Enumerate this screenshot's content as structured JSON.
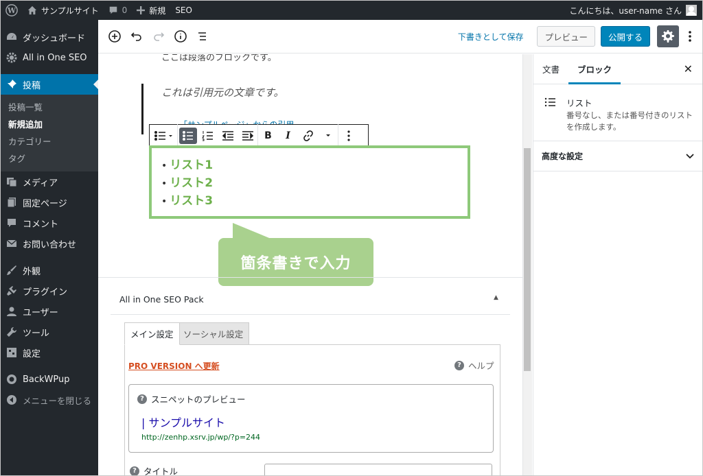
{
  "adminbar": {
    "site_name": "サンプルサイト",
    "comments_count": "0",
    "new_label": "新規",
    "seo_label": "SEO",
    "greeting": "こんにちは、user-name さん"
  },
  "sidebar": {
    "items": [
      {
        "label": "ダッシュボード",
        "icon": "dashboard-icon"
      },
      {
        "label": "All in One SEO",
        "icon": "gear-icon"
      },
      {
        "label": "投稿",
        "icon": "pin-icon"
      },
      {
        "label": "メディア",
        "icon": "media-icon"
      },
      {
        "label": "固定ページ",
        "icon": "page-icon"
      },
      {
        "label": "コメント",
        "icon": "comment-icon"
      },
      {
        "label": "お問い合わせ",
        "icon": "mail-icon"
      },
      {
        "label": "外観",
        "icon": "brush-icon"
      },
      {
        "label": "プラグイン",
        "icon": "plugin-icon"
      },
      {
        "label": "ユーザー",
        "icon": "user-icon"
      },
      {
        "label": "ツール",
        "icon": "wrench-icon"
      },
      {
        "label": "設定",
        "icon": "settings-icon"
      },
      {
        "label": "BackWPup",
        "icon": "backwpup-icon"
      },
      {
        "label": "メニューを閉じる",
        "icon": "collapse-icon"
      }
    ],
    "submenu": [
      "投稿一覧",
      "新規追加",
      "カテゴリー",
      "タグ"
    ]
  },
  "header": {
    "save_draft": "下書きとして保存",
    "preview": "プレビュー",
    "publish": "公開する"
  },
  "editor": {
    "paragraph_text": "ここは段落のブロックです。",
    "quote_text": "これは引用元の文章です。",
    "cite_text": "「サンプルページ」からの引用",
    "list_items": [
      "リスト1",
      "リスト2",
      "リスト3"
    ],
    "callout": "箇条書きで入力"
  },
  "aioseo": {
    "title": "All in One SEO Pack",
    "tab_main": "メイン設定",
    "tab_social": "ソーシャル設定",
    "pro_link": "PRO VERSION へ更新",
    "help": "ヘルプ",
    "snippet_title": "スニペットのプレビュー",
    "snippet_link": "| サンプルサイト",
    "snippet_url": "http://zenhp.xsrv.jp/wp/?p=244",
    "title_label": "タイトル"
  },
  "settings_panel": {
    "tab_document": "文書",
    "tab_block": "ブロック",
    "block_name": "リスト",
    "block_desc": "番号なし、または番号付きのリストを作成します。",
    "advanced": "高度な設定"
  },
  "colors": {
    "admin_dark": "#23282d",
    "active_blue": "#0073aa",
    "highlight_green": "#8ec97a",
    "callout_green": "#a9d18e"
  }
}
